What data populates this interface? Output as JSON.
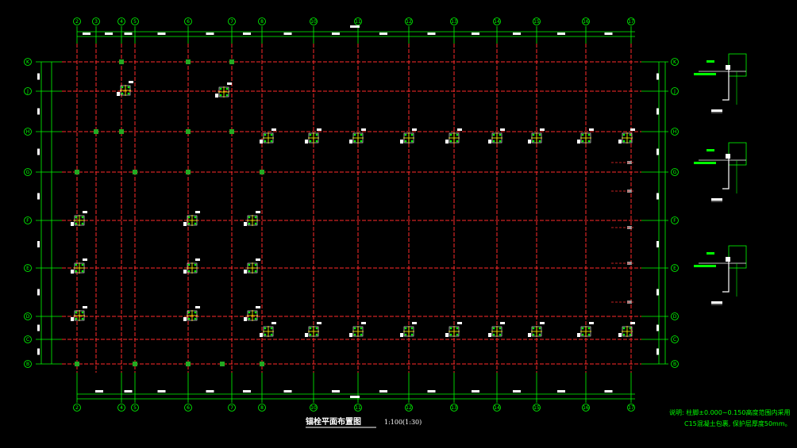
{
  "top_axes": [
    "2",
    "3",
    "4",
    "5",
    "6",
    "7",
    "8",
    "10",
    "11",
    "12",
    "13",
    "14",
    "15",
    "16",
    "17"
  ],
  "bottom_axes": [
    "2",
    "4",
    "5",
    "6",
    "7",
    "8",
    "10",
    "11",
    "12",
    "13",
    "14",
    "15",
    "16",
    "17"
  ],
  "row_axes": [
    "K",
    "J",
    "H",
    "G",
    "F",
    "E",
    "D",
    "C",
    "B"
  ],
  "drawing_title": "锚栓平面布置图",
  "drawing_scale": "1:100(1:30)",
  "note_line1": "说明: 柱脚±0.000~0.150高度范围内采用",
  "note_line2": "C15混凝土包裹, 保护层厚度50mm。",
  "colors": {
    "background": "#000000",
    "grid_red": "#ff2a2a",
    "dim_green": "#00ff00",
    "column_green": "#22aa22",
    "white": "#ffffff",
    "yellow": "#ffff00"
  }
}
